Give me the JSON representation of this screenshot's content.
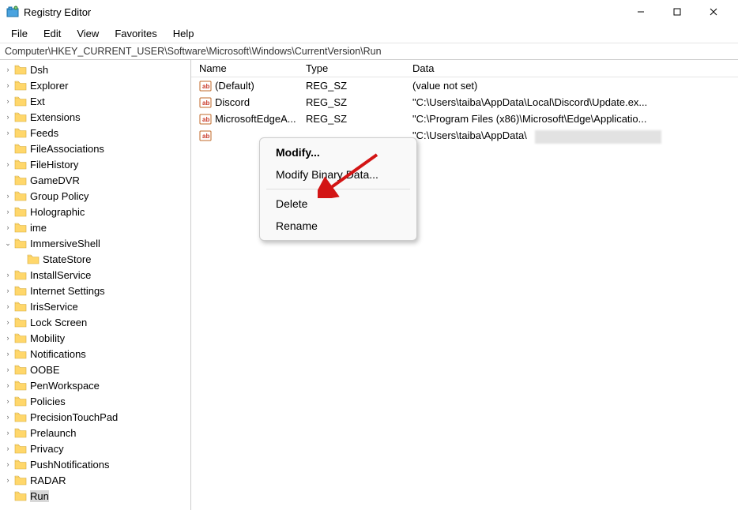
{
  "window": {
    "title": "Registry Editor"
  },
  "menu": {
    "file": "File",
    "edit": "Edit",
    "view": "View",
    "favorites": "Favorites",
    "help": "Help"
  },
  "address": "Computer\\HKEY_CURRENT_USER\\Software\\Microsoft\\Windows\\CurrentVersion\\Run",
  "tree": [
    {
      "label": "Dsh",
      "chev": ">"
    },
    {
      "label": "Explorer",
      "chev": ">"
    },
    {
      "label": "Ext",
      "chev": ">"
    },
    {
      "label": "Extensions",
      "chev": ">"
    },
    {
      "label": "Feeds",
      "chev": ">"
    },
    {
      "label": "FileAssociations",
      "chev": ""
    },
    {
      "label": "FileHistory",
      "chev": ">"
    },
    {
      "label": "GameDVR",
      "chev": ""
    },
    {
      "label": "Group Policy",
      "chev": ">"
    },
    {
      "label": "Holographic",
      "chev": ">"
    },
    {
      "label": "ime",
      "chev": ">"
    },
    {
      "label": "ImmersiveShell",
      "chev": "v",
      "children": [
        {
          "label": "StateStore"
        }
      ]
    },
    {
      "label": "InstallService",
      "chev": ">"
    },
    {
      "label": "Internet Settings",
      "chev": ">"
    },
    {
      "label": "IrisService",
      "chev": ">"
    },
    {
      "label": "Lock Screen",
      "chev": ">"
    },
    {
      "label": "Mobility",
      "chev": ">"
    },
    {
      "label": "Notifications",
      "chev": ">"
    },
    {
      "label": "OOBE",
      "chev": ">"
    },
    {
      "label": "PenWorkspace",
      "chev": ">"
    },
    {
      "label": "Policies",
      "chev": ">"
    },
    {
      "label": "PrecisionTouchPad",
      "chev": ">"
    },
    {
      "label": "Prelaunch",
      "chev": ">"
    },
    {
      "label": "Privacy",
      "chev": ">"
    },
    {
      "label": "PushNotifications",
      "chev": ">"
    },
    {
      "label": "RADAR",
      "chev": ">"
    },
    {
      "label": "Run",
      "chev": "",
      "selected": true
    }
  ],
  "list": {
    "cols": {
      "name": "Name",
      "type": "Type",
      "data": "Data"
    },
    "rows": [
      {
        "name": "(Default)",
        "type": "REG_SZ",
        "data": "(value not set)"
      },
      {
        "name": "Discord",
        "type": "REG_SZ",
        "data": "\"C:\\Users\\taiba\\AppData\\Local\\Discord\\Update.ex..."
      },
      {
        "name": "MicrosoftEdgeA...",
        "type": "REG_SZ",
        "data": "\"C:\\Program Files (x86)\\Microsoft\\Edge\\Applicatio..."
      },
      {
        "name": "",
        "type": "",
        "data": "\"C:\\Users\\taiba\\AppData\\",
        "selected": true,
        "partialBlur": true
      }
    ]
  },
  "context": {
    "modify": "Modify...",
    "modifyBinary": "Modify Binary Data...",
    "delete": "Delete",
    "rename": "Rename"
  }
}
